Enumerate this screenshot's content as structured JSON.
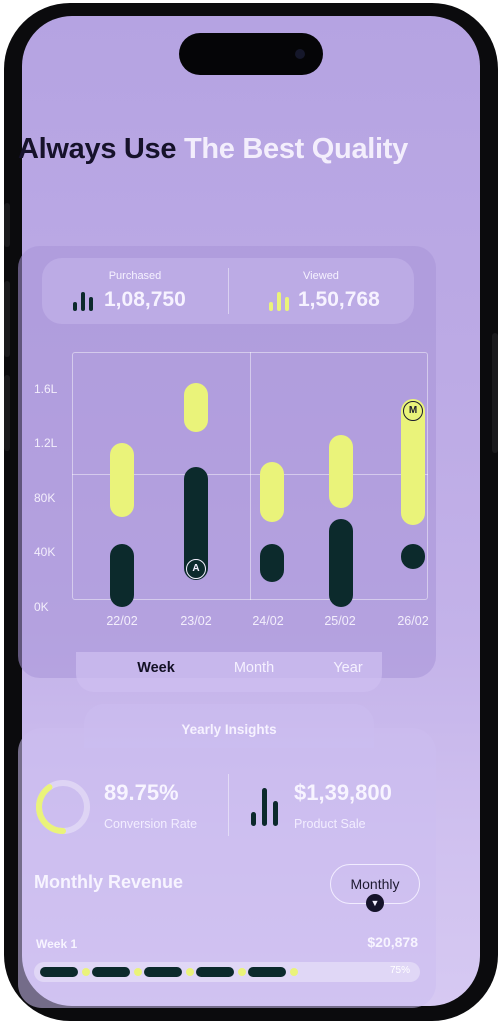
{
  "headline": {
    "part1": "Always Use ",
    "part2": "The Best Quality"
  },
  "stats": {
    "purchased": {
      "label": "Purchased",
      "value": "1,08,750"
    },
    "viewed": {
      "label": "Viewed",
      "value": "1,50,768"
    }
  },
  "chart_data": {
    "type": "bar",
    "categories": [
      "22/02",
      "23/02",
      "24/02",
      "25/02",
      "26/02"
    ],
    "y_tick_labels": [
      "1.6L",
      "1.2L",
      "80K",
      "40K",
      "0K"
    ],
    "ylim": [
      0,
      160000
    ],
    "series": [
      {
        "color": "#eaf37a",
        "ranges": [
          [
            66000,
            120000
          ],
          [
            128000,
            164000
          ],
          [
            62000,
            106000
          ],
          [
            72000,
            126000
          ],
          [
            60000,
            152000
          ]
        ]
      },
      {
        "color": "#0c2a2c",
        "ranges": [
          [
            0,
            46000
          ],
          [
            20000,
            102000
          ],
          [
            18000,
            46000
          ],
          [
            0,
            64000
          ],
          [
            28000,
            46000
          ]
        ]
      }
    ],
    "markers": [
      {
        "category": "23/02",
        "label": "A",
        "value": 28000
      },
      {
        "category": "26/02",
        "label": "M",
        "value": 143000
      }
    ],
    "colors": {
      "yellow": "#eaf37a",
      "dark": "#0c2a2c"
    }
  },
  "tabs": {
    "week": "Week",
    "month": "Month",
    "year": "Year",
    "active": "Week"
  },
  "insights": {
    "title": "Yearly Insights",
    "conversion": {
      "value": "89.75%",
      "label": "Conversion Rate",
      "percent": 89.75
    },
    "sale": {
      "value": "$1,39,800",
      "label": "Product Sale"
    }
  },
  "revenue": {
    "title": "Monthly Revenue",
    "period_button": "Monthly",
    "week_label": "Week 1",
    "amount": "$20,878",
    "progress_label": "75%",
    "progress_percent": 75
  },
  "icons": {
    "purchased": "bar-chart-icon",
    "viewed": "bar-chart-icon",
    "sale": "bar-chart-icon",
    "dropdown": "chevron-down-icon",
    "marker_a": "marker-a-icon",
    "marker_m": "marker-m-icon"
  }
}
